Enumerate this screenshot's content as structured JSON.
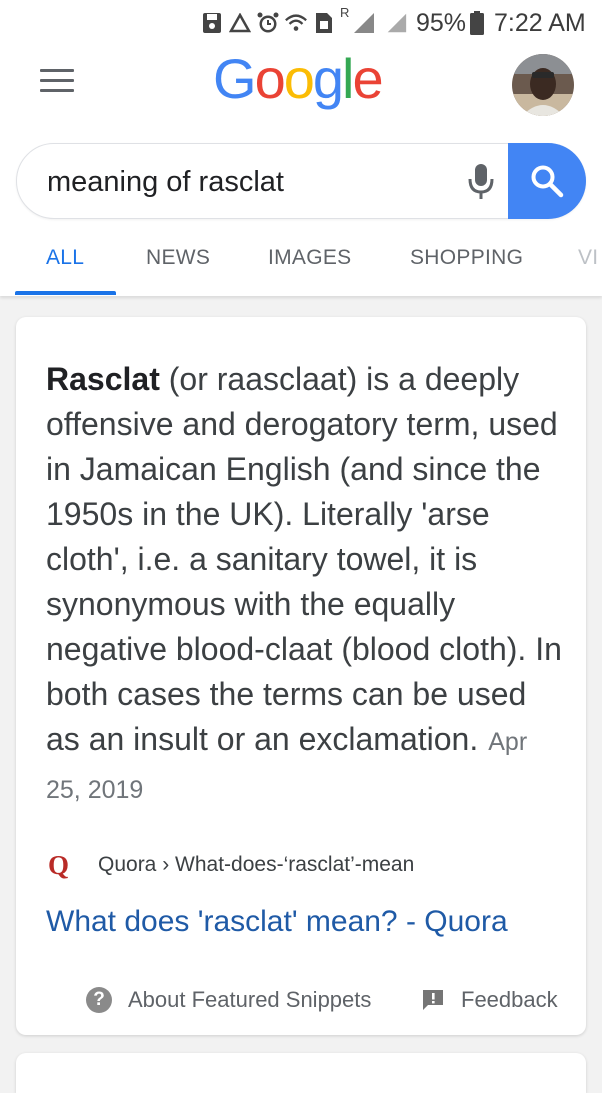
{
  "status_bar": {
    "icons": [
      "save-icon",
      "recycle-icon",
      "alarm-icon",
      "wifi-icon",
      "sim-icon",
      "roaming-signal-icon",
      "signal-icon"
    ],
    "roaming_indicator": "R",
    "battery_percent": "95%",
    "time": "7:22 AM"
  },
  "header": {
    "menu_icon": "hamburger-menu-icon",
    "logo_text": "Google",
    "logo_colors": [
      "#4285f4",
      "#ea4335",
      "#fbbc05",
      "#4285f4",
      "#34a853",
      "#ea4335"
    ],
    "avatar": "user-avatar"
  },
  "search": {
    "query": "meaning of rasclat",
    "mic_icon": "microphone-icon",
    "search_icon": "magnifier-icon",
    "button_color": "#4285f4"
  },
  "tabs": [
    {
      "label": "ALL",
      "active": true
    },
    {
      "label": "NEWS",
      "active": false
    },
    {
      "label": "IMAGES",
      "active": false
    },
    {
      "label": "SHOPPING",
      "active": false
    },
    {
      "label": "VI",
      "active": false
    }
  ],
  "accent_color": "#1a73e8",
  "featured_snippet": {
    "term": "Rasclat",
    "text": " (or raasclaat) is a deeply offensive and derogatory term, used in Jamaican English (and since the 1950s in the UK). Literally 'arse cloth', i.e. a sanitary towel, it is synonymous with the equally negative blood-claat (blood cloth). In both cases the terms can be used as an insult or an exclamation.",
    "date": "Apr 25, 2019",
    "source_logo": "Q",
    "source": "Quora › What-does-‘rasclat’-mean",
    "link_title": "What does 'rasclat' mean? - Quora",
    "about_label": "About Featured Snippets",
    "about_icon": "?",
    "feedback_label": "Feedback",
    "feedback_icon": "feedback-icon"
  }
}
